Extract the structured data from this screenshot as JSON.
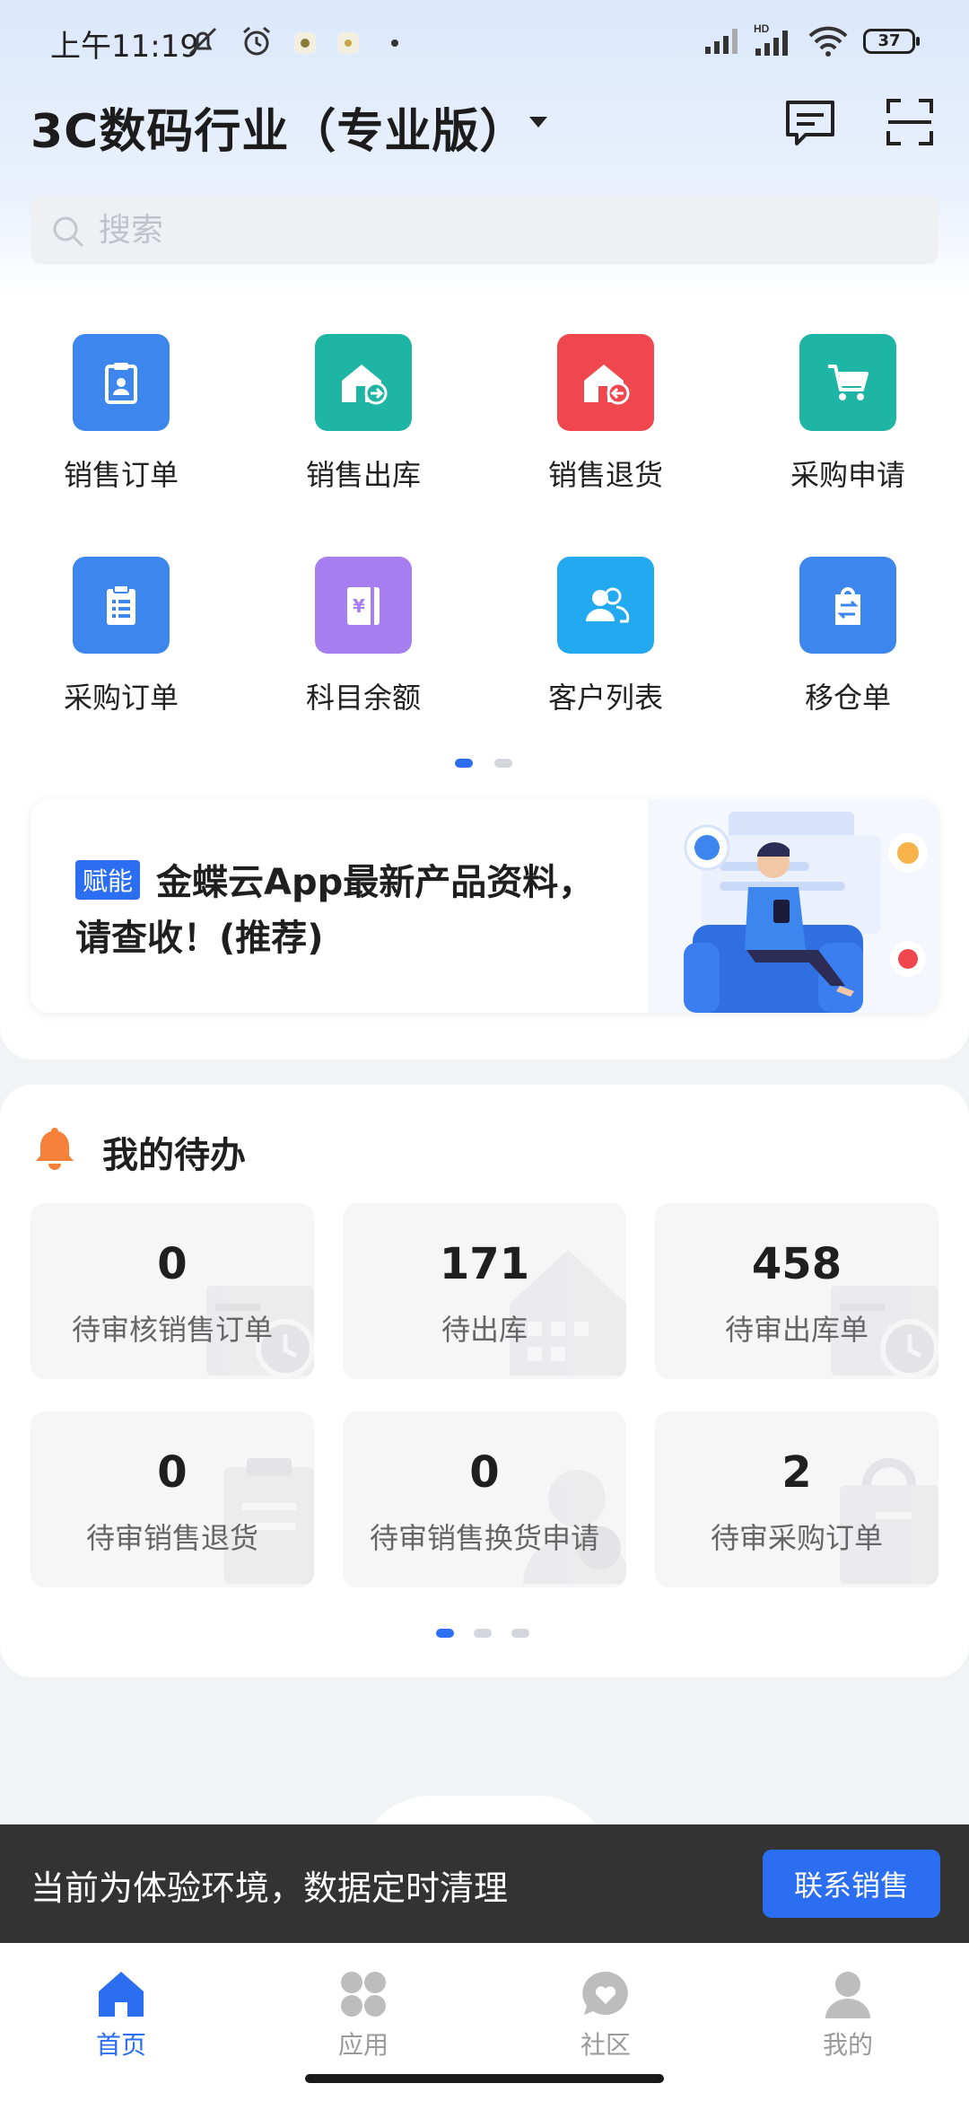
{
  "status_bar": {
    "time": "上午11:19",
    "battery": "37",
    "network_label": "HD"
  },
  "header": {
    "title": "3C数码行业（专业版）"
  },
  "search": {
    "placeholder": "搜索"
  },
  "grid": {
    "items": [
      {
        "label": "销售订单",
        "icon": "sales-order-icon",
        "color": "#3d86ee"
      },
      {
        "label": "销售出库",
        "icon": "sales-outbound-icon",
        "color": "#1fb5a4"
      },
      {
        "label": "销售退货",
        "icon": "sales-return-icon",
        "color": "#f0474f"
      },
      {
        "label": "采购申请",
        "icon": "purchase-request-icon",
        "color": "#1fb5a4"
      },
      {
        "label": "采购订单",
        "icon": "purchase-order-icon",
        "color": "#3d86ee"
      },
      {
        "label": "科目余额",
        "icon": "account-balance-icon",
        "color": "#a77ef0"
      },
      {
        "label": "客户列表",
        "icon": "customer-list-icon",
        "color": "#22a9f0"
      },
      {
        "label": "移仓单",
        "icon": "transfer-icon",
        "color": "#3d86ee"
      }
    ]
  },
  "banner": {
    "tag": "赋能",
    "title_line1": "金蝶云App最新产品资料，",
    "title_line2": "请查收！(推荐)"
  },
  "todo": {
    "title": "我的待办",
    "items": [
      {
        "count": "0",
        "label": "待审核销售订单"
      },
      {
        "count": "171",
        "label": "待出库"
      },
      {
        "count": "458",
        "label": "待审出库单"
      },
      {
        "count": "0",
        "label": "待审销售退货"
      },
      {
        "count": "0",
        "label": "待审销售换货申请"
      },
      {
        "count": "2",
        "label": "待审采购订单"
      }
    ]
  },
  "trial": {
    "text": "当前为体验环境，数据定时清理",
    "button": "联系销售"
  },
  "nav": {
    "items": [
      {
        "label": "首页",
        "icon": "home-icon",
        "active": true
      },
      {
        "label": "应用",
        "icon": "apps-icon",
        "active": false
      },
      {
        "label": "社区",
        "icon": "community-icon",
        "active": false
      },
      {
        "label": "我的",
        "icon": "profile-icon",
        "active": false
      }
    ]
  },
  "colors": {
    "accent": "#2b6ef2",
    "bell": "#f5813a"
  }
}
